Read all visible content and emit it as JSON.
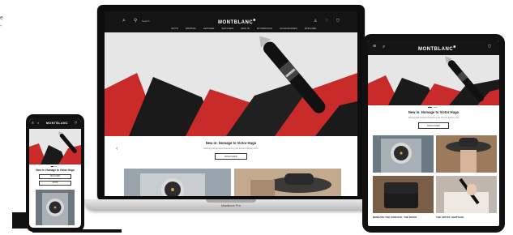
{
  "brand": {
    "logo_text": "MONTBLANC",
    "logo_star": "✱"
  },
  "laptop": {
    "nav_links": [
      "GIFTS",
      "WRITING",
      "LEATHER",
      "WATCHES",
      "NEW IN",
      "NOTEBOOKS",
      "ACCESSORIES",
      "EXPLORE"
    ],
    "search_hint": "Search",
    "promo_title": "New in: Homage to Victor Hugo",
    "promo_sub": "Writing instruments inspired by the French literary icon",
    "promo_button": "DISCOVER",
    "device_label": "MacBook Pro"
  },
  "tablet": {
    "promo_title": "New in: Homage to Victor Hugo",
    "promo_sub": "Writing instruments inspired by the French literary icon",
    "promo_button": "DISCOVER",
    "caption_left": "BENEATH THE SURFACE: THE MOON",
    "caption_right": "THE ARTIST: HERITAGE"
  },
  "phone": {
    "promo_title": "New in: Homage to Victor Hugo",
    "promo_button": "DISCOVER",
    "button2": "SHOP"
  },
  "edge_text": [
    "e",
    "-"
  ],
  "colors": {
    "header_bg": "#141414",
    "hero_red": "#c92b2b",
    "hero_dark": "#1a1a1a",
    "hero_light": "#dcdcdc",
    "device_body": "#111111"
  }
}
